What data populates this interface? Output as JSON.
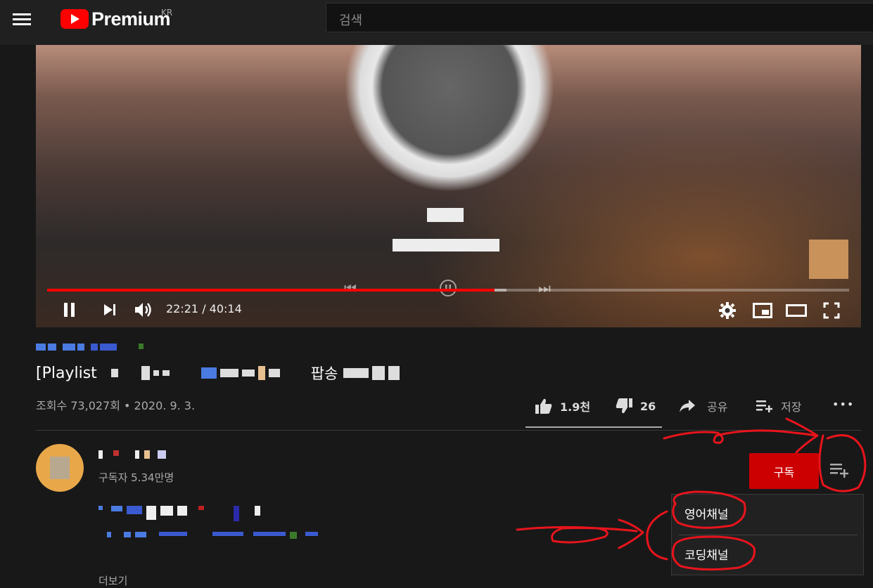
{
  "header": {
    "logo_text": "Premium",
    "region": "KR",
    "search_placeholder": "검색"
  },
  "player": {
    "time_display": "22:21 / 40:14",
    "progress_fraction": 0.558,
    "buffered_fraction": 0.573
  },
  "video": {
    "title_prefix": "[Playlist",
    "title_word": "팝송",
    "views_date": "조회수 73,027회 • 2020. 9. 3.",
    "likes": "1.9천",
    "dislikes": "26",
    "share_label": "공유",
    "save_label": "저장",
    "more_label": "•••"
  },
  "channel": {
    "subscribers": "구독자 5.34만명",
    "subscribe_label": "구독",
    "show_more": "더보기"
  },
  "playlist_menu": {
    "items": [
      "영어채널",
      "코딩채널"
    ]
  },
  "colors": {
    "background": "#181818",
    "masthead": "#202020",
    "accent_red": "#ff0000",
    "subscribe_red": "#cc0000",
    "annotation_red": "#e8141c"
  },
  "icons": [
    "menu-icon",
    "youtube-logo-icon",
    "pause-icon",
    "skip-next-icon",
    "volume-icon",
    "settings-icon",
    "miniplayer-icon",
    "theater-icon",
    "fullscreen-icon",
    "thumb-up-icon",
    "thumb-down-icon",
    "share-icon",
    "add-to-playlist-icon",
    "more-icon"
  ]
}
